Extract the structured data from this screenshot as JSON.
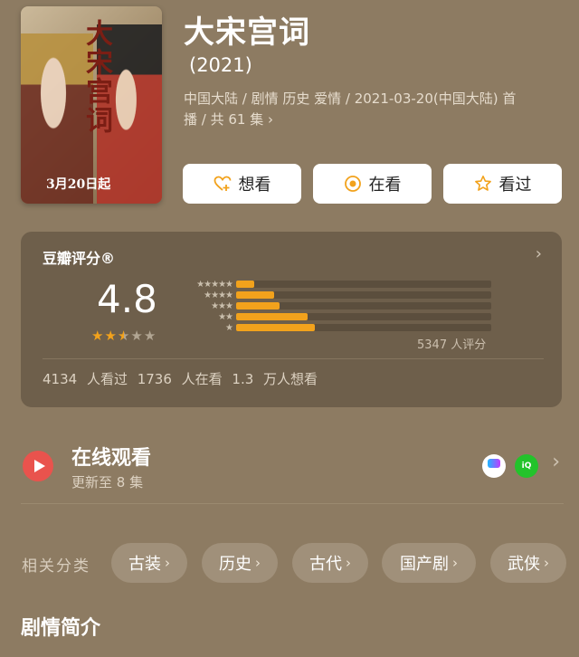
{
  "movie": {
    "title": "大宋宫词",
    "year": "(2021)",
    "meta_line1": "中国大陆 / 剧情 历史 爱情 / 2021-03-20(中国大陆) 首",
    "meta_line2": "播 / 共 61 集",
    "poster_title": "大宋宫词",
    "poster_date": "3月20日起"
  },
  "actions": [
    {
      "label": "想看",
      "icon": "heart-plus-icon"
    },
    {
      "label": "在看",
      "icon": "target-icon"
    },
    {
      "label": "看过",
      "icon": "star-outline-icon"
    }
  ],
  "rating": {
    "title": "豆瓣评分®",
    "score": "4.8",
    "stars_filled": 2.5,
    "count": "5347 人评分",
    "distribution": [
      {
        "stars": "★★★★★",
        "fraction": 0.07
      },
      {
        "stars": "★★★★",
        "fraction": 0.15
      },
      {
        "stars": "★★★",
        "fraction": 0.17
      },
      {
        "stars": "★★",
        "fraction": 0.28
      },
      {
        "stars": "★",
        "fraction": 0.31
      }
    ],
    "stats": "4134 人看过   1736 人在看   1.3 万人想看"
  },
  "watch": {
    "title": "在线观看",
    "subtitle": "更新至 8 集",
    "platforms": [
      "YOUKU",
      "iQIYI"
    ]
  },
  "related": {
    "label": "相关分类",
    "chips": [
      "古装",
      "历史",
      "古代",
      "国产剧",
      "武侠"
    ]
  },
  "synopsis": {
    "heading": "剧情简介"
  },
  "colors": {
    "background": "#8d7b62",
    "accent": "#f2a21c",
    "play": "#e9534d"
  }
}
